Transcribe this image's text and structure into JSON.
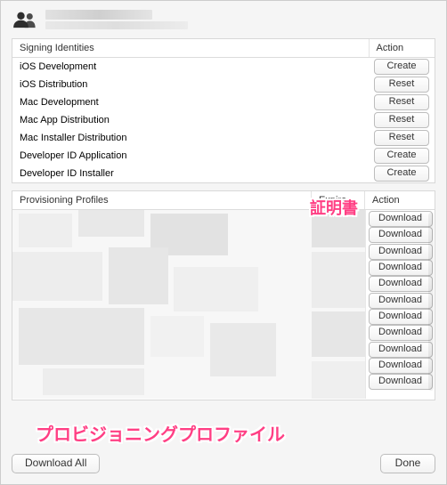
{
  "account": {
    "name_redacted": true,
    "email_redacted": true
  },
  "signing": {
    "header_identity": "Signing Identities",
    "header_action": "Action",
    "rows": [
      {
        "name": "iOS Development",
        "action": "Create"
      },
      {
        "name": "iOS Distribution",
        "action": "Reset"
      },
      {
        "name": "Mac Development",
        "action": "Reset"
      },
      {
        "name": "Mac App Distribution",
        "action": "Reset"
      },
      {
        "name": "Mac Installer Distribution",
        "action": "Reset"
      },
      {
        "name": "Developer ID Application",
        "action": "Create"
      },
      {
        "name": "Developer ID Installer",
        "action": "Create"
      }
    ]
  },
  "annotations": {
    "certificates": "証明書",
    "provisioning": "プロビジョニングプロファイル"
  },
  "provisioning": {
    "header_name": "Provisioning Profiles",
    "header_expires": "Expires",
    "header_action": "Action",
    "download_label": "Download",
    "row_count": 11
  },
  "footer": {
    "download_all": "Download All",
    "done": "Done"
  }
}
